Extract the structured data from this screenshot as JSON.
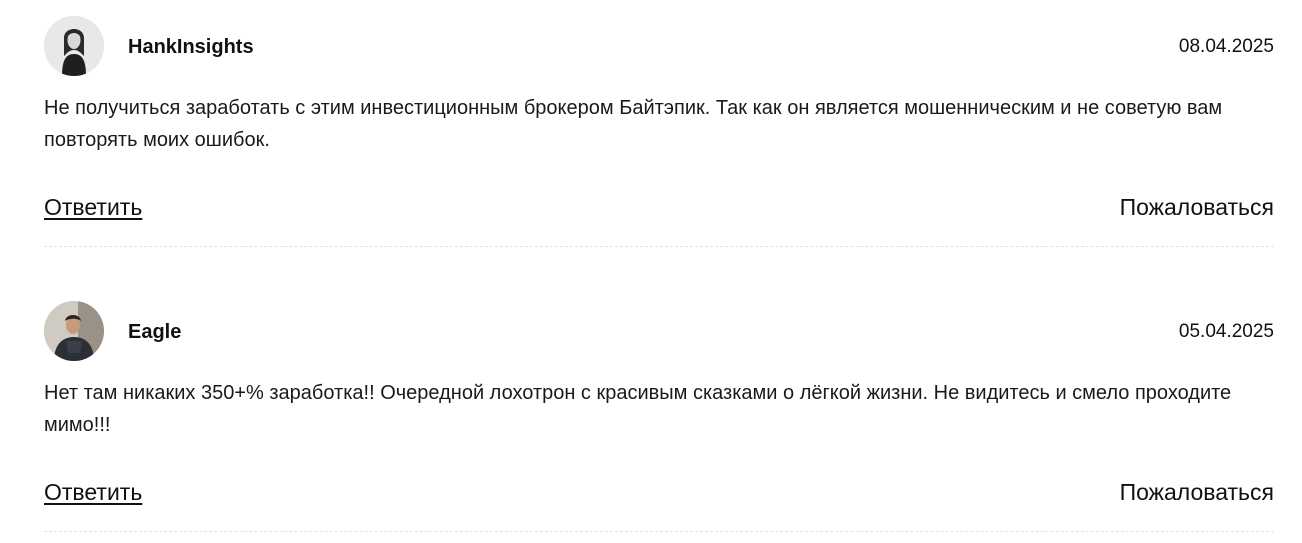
{
  "comments": [
    {
      "author": "HankInsights",
      "date": "08.04.2025",
      "text": "Не получиться заработать с этим инвестиционным брокером Байтэпик. Так как он является мошенническим и не советую вам повторять моих ошибок.",
      "reply_label": "Ответить",
      "report_label": "Пожаловаться",
      "avatar_icon": "user-avatar-photo"
    },
    {
      "author": "Eagle",
      "date": "05.04.2025",
      "text": "Нет там никаких 350+% заработка!! Очередной лохотрон с красивым сказками о лёгкой жизни. Не видитесь и смело проходите мимо!!!",
      "reply_label": "Ответить",
      "report_label": "Пожаловаться",
      "avatar_icon": "user-avatar-photo"
    }
  ]
}
